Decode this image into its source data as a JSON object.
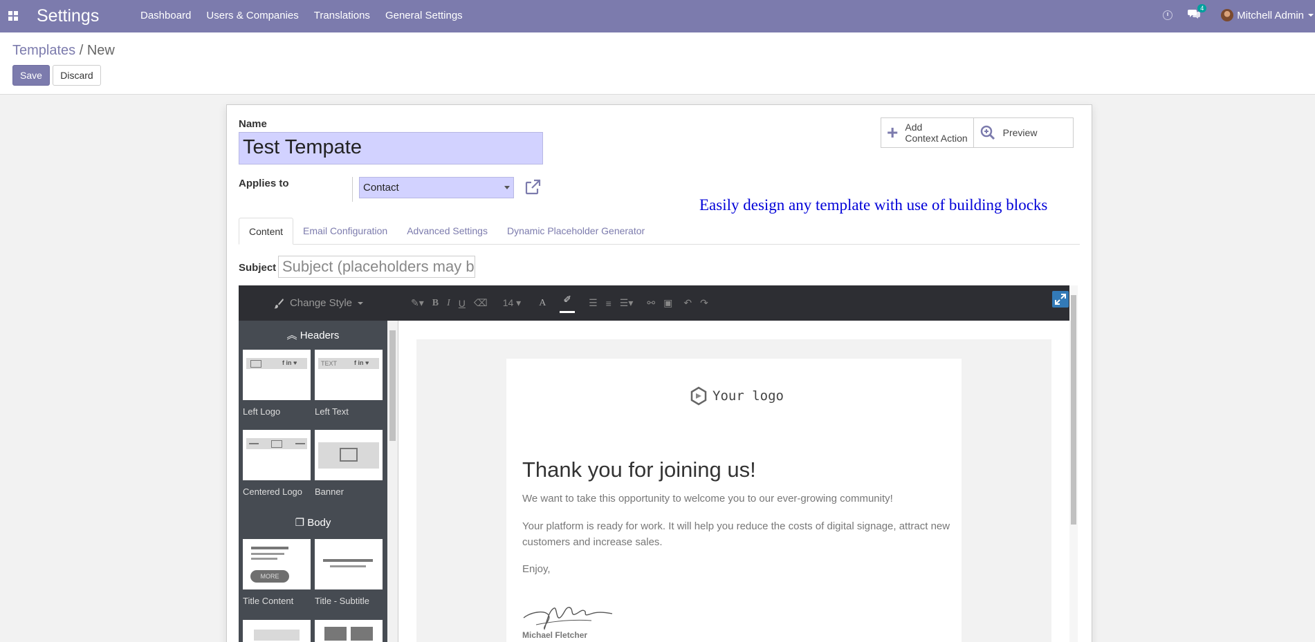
{
  "navbar": {
    "app_title": "Settings",
    "menu": [
      "Dashboard",
      "Users & Companies",
      "Translations",
      "General Settings"
    ],
    "chat_count": "4",
    "user_name": "Mitchell Admin"
  },
  "breadcrumb": {
    "parent": "Templates",
    "separator": "/",
    "current": "New"
  },
  "buttons": {
    "save": "Save",
    "discard": "Discard"
  },
  "form": {
    "name_label": "Name",
    "name_value": "Test Tempate",
    "applies_label": "Applies to",
    "applies_value": "Contact",
    "annotation": "Easily design any template with use of building blocks",
    "action_add_line1": "Add",
    "action_add_line2": "Context Action",
    "action_preview": "Preview",
    "tabs": [
      "Content",
      "Email Configuration",
      "Advanced Settings",
      "Dynamic Placeholder Generator"
    ],
    "subject_label": "Subject",
    "subject_placeholder": "Subject (placeholders may be used here)"
  },
  "editor": {
    "change_style": "Change Style",
    "font_size": "14",
    "categories": {
      "headers": "Headers",
      "body": "Body"
    },
    "snippets": [
      "Left Logo",
      "Left Text",
      "Centered Logo",
      "Banner",
      "Title Content",
      "Title - Subtitle"
    ],
    "snippet_more_label": "MORE",
    "snippet_text_label": "TEXT"
  },
  "email": {
    "logo_text": "Your logo",
    "heading": "Thank you for joining us!",
    "para1": "We want to take this opportunity to welcome you to our ever-growing community!",
    "para2": "Your platform is ready for work. It will help you reduce the costs of digital signage, attract new customers and increase sales.",
    "para3": "Enjoy,",
    "signature_name": "Michael Fletcher"
  },
  "colors": {
    "brand": "#7c7bad",
    "annotation": "#0000d8",
    "field_bg": "#d2d2ff"
  }
}
